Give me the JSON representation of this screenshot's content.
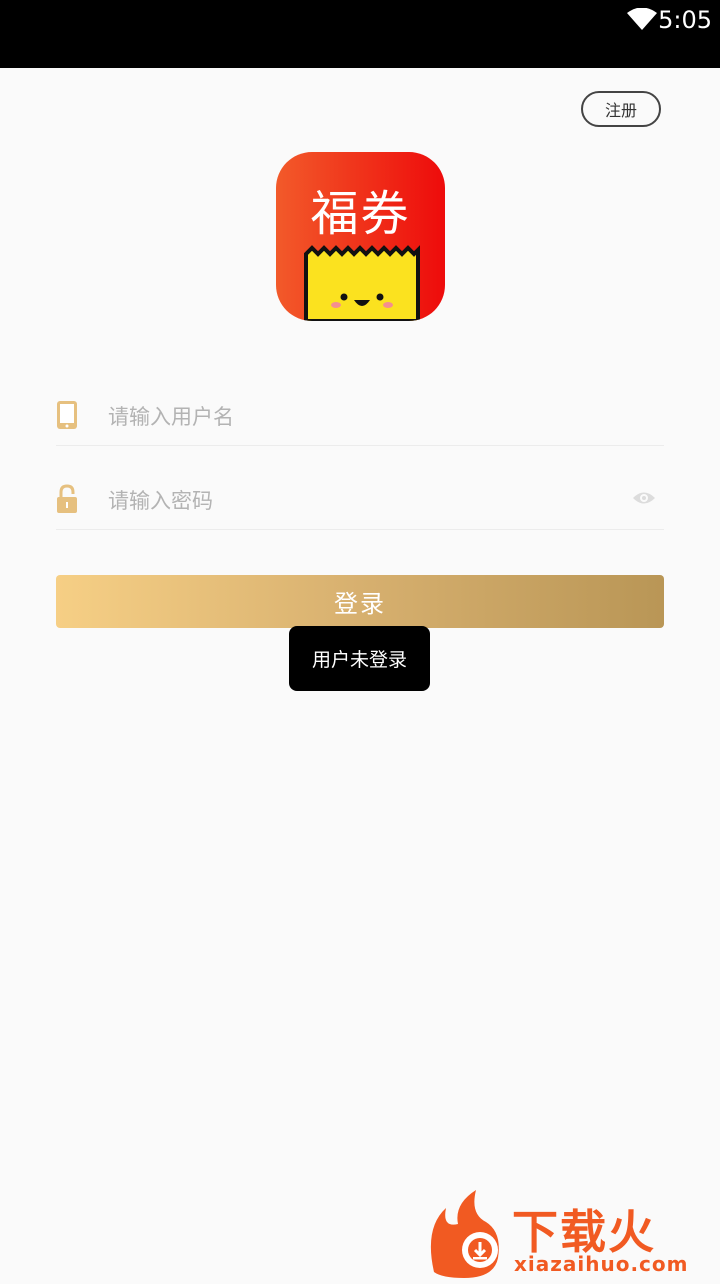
{
  "status_bar": {
    "time": "5:05",
    "wifi_icon": "wifi-icon"
  },
  "header": {
    "register_label": "注册"
  },
  "logo": {
    "title": "福券"
  },
  "form": {
    "username_placeholder": "请输入用户名",
    "password_placeholder": "请输入密码",
    "username_icon": "phone-icon",
    "password_icon": "lock-icon",
    "visibility_icon": "eye-icon"
  },
  "login": {
    "label": "登录"
  },
  "toast": {
    "message": "用户未登录"
  },
  "watermark": {
    "title": "下载火",
    "url": "xiazaihuo.com"
  },
  "colors": {
    "accent_start": "#f6cf85",
    "accent_end": "#b99656",
    "logo_red": "#f02d12",
    "watermark": "#f15a22"
  }
}
